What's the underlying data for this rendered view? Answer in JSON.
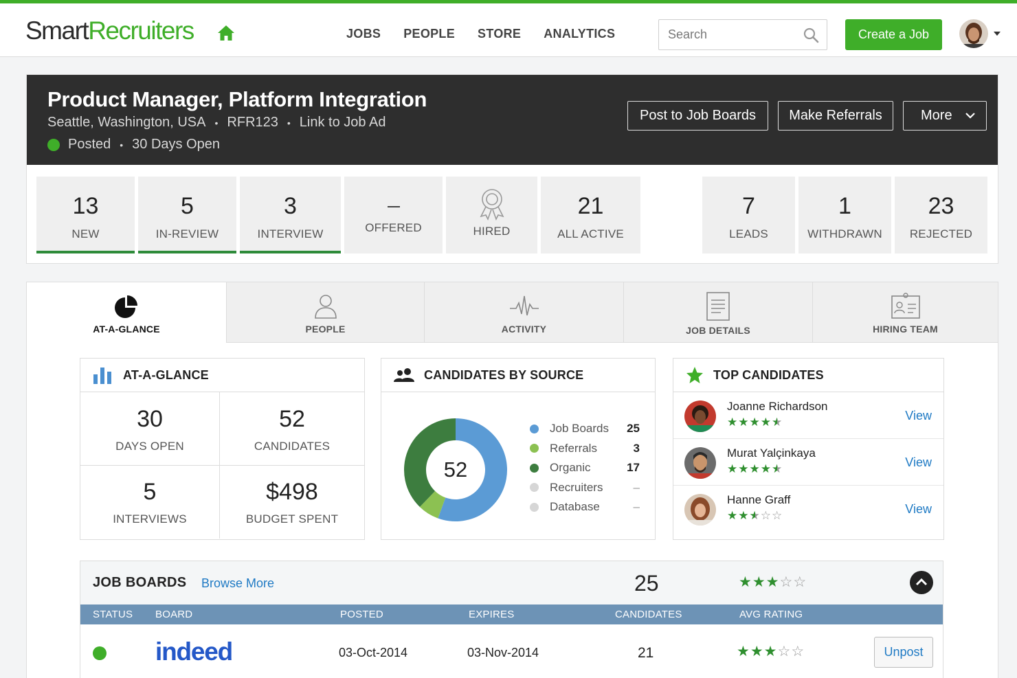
{
  "brand": {
    "part1": "Smart",
    "part2": "Recruiters",
    "accent": "#3fae29"
  },
  "nav": {
    "items": [
      "JOBS",
      "PEOPLE",
      "STORE",
      "ANALYTICS"
    ]
  },
  "search": {
    "placeholder": "Search"
  },
  "create_job_label": "Create a Job",
  "job": {
    "title": "Product Manager, Platform Integration",
    "location": "Seattle, Washington, USA",
    "ref": "RFR123",
    "link_label": "Link to Job Ad",
    "status": "Posted",
    "days_open_label": "30 Days Open",
    "buttons": {
      "post": "Post to Job Boards",
      "referrals": "Make Referrals",
      "more": "More"
    }
  },
  "pipeline": [
    {
      "num": "13",
      "label": "NEW",
      "active": true
    },
    {
      "num": "5",
      "label": "IN-REVIEW",
      "active": true
    },
    {
      "num": "3",
      "label": "INTERVIEW",
      "active": true
    },
    {
      "num": "",
      "label": "OFFERED",
      "active": false
    },
    {
      "num": "",
      "label": "HIRED",
      "active": false,
      "icon": "award-icon"
    },
    {
      "num": "21",
      "label": "ALL ACTIVE",
      "active": false
    },
    {
      "num": "7",
      "label": "LEADS",
      "active": false
    },
    {
      "num": "1",
      "label": "WITHDRAWN",
      "active": false
    },
    {
      "num": "23",
      "label": "REJECTED",
      "active": false
    }
  ],
  "tabs": [
    {
      "label": "AT-A-GLANCE",
      "icon": "pie-chart-icon",
      "active": true
    },
    {
      "label": "PEOPLE",
      "icon": "person-icon"
    },
    {
      "label": "ACTIVITY",
      "icon": "pulse-icon"
    },
    {
      "label": "JOB DETAILS",
      "icon": "document-icon"
    },
    {
      "label": "HIRING TEAM",
      "icon": "id-card-icon"
    }
  ],
  "glance": {
    "title": "AT-A-GLANCE",
    "cells": [
      {
        "num": "30",
        "label": "DAYS OPEN"
      },
      {
        "num": "52",
        "label": "CANDIDATES"
      },
      {
        "num": "5",
        "label": "INTERVIEWS"
      },
      {
        "num": "$498",
        "label": "BUDGET SPENT"
      }
    ]
  },
  "sources": {
    "title": "CANDIDATES BY SOURCE",
    "total": "52",
    "items": [
      {
        "name": "Job Boards",
        "value": "25",
        "color": "#5b9bd5"
      },
      {
        "name": "Referrals",
        "value": "3",
        "color": "#8cc152"
      },
      {
        "name": "Organic",
        "value": "17",
        "color": "#3d7d3f"
      },
      {
        "name": "Recruiters",
        "value": "–",
        "color": "#d6d6d6"
      },
      {
        "name": "Database",
        "value": "–",
        "color": "#d6d6d6"
      }
    ]
  },
  "top_candidates": {
    "title": "TOP CANDIDATES",
    "view_label": "View",
    "items": [
      {
        "name": "Joanne Richardson",
        "rating": 4.5
      },
      {
        "name": "Murat Yalçinkaya",
        "rating": 4.5
      },
      {
        "name": "Hanne Graff",
        "rating": 2.5
      }
    ]
  },
  "job_boards": {
    "title": "JOB BOARDS",
    "browse_label": "Browse More",
    "count": "25",
    "rating": 3,
    "columns": [
      "STATUS",
      "BOARD",
      "POSTED",
      "EXPIRES",
      "CANDIDATES",
      "AVG RATING"
    ],
    "rows": [
      {
        "board": "indeed",
        "posted": "03-Oct-2014",
        "expires": "03-Nov-2014",
        "candidates": "21",
        "rating": 3,
        "action": "Unpost"
      }
    ]
  }
}
